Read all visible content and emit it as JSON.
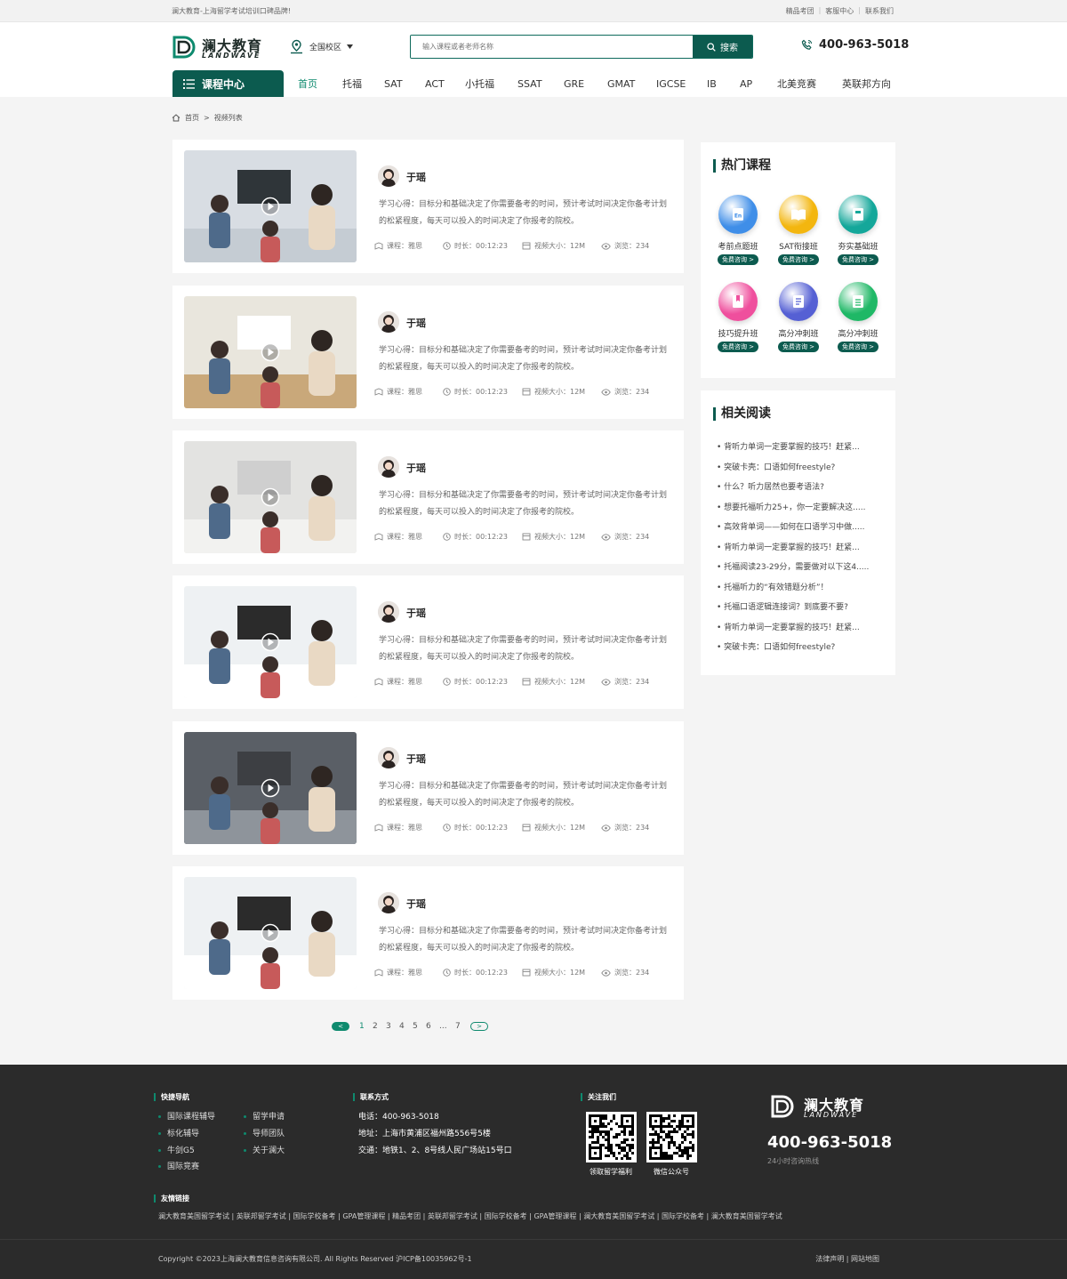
{
  "topbar": {
    "slogan": "澜大教育-上海留学考试培训口碑品牌!",
    "links": [
      "精品考团",
      "客服中心",
      "联系我们"
    ]
  },
  "header": {
    "logo_cn": "澜大教育",
    "logo_en": "LANDWAVE",
    "campus": "全国校区",
    "search_placeholder": "输入课程或者老师名称",
    "search_button": "搜索",
    "phone": "400-963-5018"
  },
  "nav": {
    "category_label": "课程中心",
    "items": [
      "首页",
      "托福",
      "SAT",
      "ACT",
      "小托福",
      "SSAT",
      "GRE",
      "GMAT",
      "IGCSE",
      "IB",
      "AP",
      "北美竞赛",
      "英联邦方向"
    ]
  },
  "breadcrumb": {
    "home": "首页",
    "sep": ">",
    "current": "视频列表"
  },
  "videos": [
    {
      "teacher": "于瑶",
      "desc": "学习心得：目标分和基础决定了你需要备考的时间，预计考试时间决定你备考计划的松紧程度，每天可以投入的时间决定了你报考的院校。",
      "course": "课程：雅思",
      "duration": "时长：00:12:23",
      "size": "视频大小：12M",
      "views": "浏览：234"
    },
    {
      "teacher": "于瑶",
      "desc": "学习心得：目标分和基础决定了你需要备考的时间，预计考试时间决定你备考计划的松紧程度，每天可以投入的时间决定了你报考的院校。",
      "course": "课程：雅思",
      "duration": "时长：00:12:23",
      "size": "视频大小：12M",
      "views": "浏览：234"
    },
    {
      "teacher": "于瑶",
      "desc": "学习心得：目标分和基础决定了你需要备考的时间，预计考试时间决定你备考计划的松紧程度，每天可以投入的时间决定了你报考的院校。",
      "course": "课程：雅思",
      "duration": "时长：00:12:23",
      "size": "视频大小：12M",
      "views": "浏览：234"
    },
    {
      "teacher": "于瑶",
      "desc": "学习心得：目标分和基础决定了你需要备考的时间，预计考试时间决定你备考计划的松紧程度，每天可以投入的时间决定了你报考的院校。",
      "course": "课程：雅思",
      "duration": "时长：00:12:23",
      "size": "视频大小：12M",
      "views": "浏览：234"
    },
    {
      "teacher": "于瑶",
      "desc": "学习心得：目标分和基础决定了你需要备考的时间，预计考试时间决定你备考计划的松紧程度，每天可以投入的时间决定了你报考的院校。",
      "course": "课程：雅思",
      "duration": "时长：00:12:23",
      "size": "视频大小：12M",
      "views": "浏览：234"
    },
    {
      "teacher": "于瑶",
      "desc": "学习心得：目标分和基础决定了你需要备考的时间，预计考试时间决定你备考计划的松紧程度，每天可以投入的时间决定了你报考的院校。",
      "course": "课程：雅思",
      "duration": "时长：00:12:23",
      "size": "视频大小：12M",
      "views": "浏览：234"
    }
  ],
  "pagination": {
    "pages": [
      "1",
      "2",
      "3",
      "4",
      "5",
      "6",
      "...",
      "7"
    ],
    "prev": "<",
    "next": ">"
  },
  "hot_courses": {
    "title": "热门课程",
    "button": "免费咨询 >",
    "items": [
      {
        "label": "考前点题班",
        "color": "#3f8ee8",
        "icon": "en-book-icon"
      },
      {
        "label": "SAT衔接班",
        "color": "#f3b60f",
        "icon": "open-book-icon"
      },
      {
        "label": "夯实基础班",
        "color": "#14a79a",
        "icon": "notebook-icon"
      },
      {
        "label": "技巧提升班",
        "color": "#ef4f9d",
        "icon": "bookmark-icon"
      },
      {
        "label": "高分冲刺班",
        "color": "#5560d4",
        "icon": "document-icon"
      },
      {
        "label": "高分冲刺班",
        "color": "#1fb866",
        "icon": "list-doc-icon"
      }
    ]
  },
  "related": {
    "title": "相关阅读",
    "items": [
      "背听力单词一定要掌握的技巧！赶紧...",
      "突破卡壳：口语如何freestyle?",
      "什么？听力居然也要考语法?",
      "想要托福听力25+，你一定要解决这.....",
      "高效背单词——如何在口语学习中做.....",
      "背听力单词一定要掌握的技巧！赶紧...",
      "托福阅读23-29分，需要做对以下这4.....",
      "托福听力的“有效错题分析”！",
      "托福口语逻辑连接词？到底要不要?",
      "背听力单词一定要掌握的技巧！赶紧...",
      "突破卡壳：口语如何freestyle?"
    ]
  },
  "footer": {
    "nav_title": "快捷导航",
    "nav_col1": [
      "国际课程辅导",
      "标化辅导",
      "牛剑G5",
      "国际竞赛"
    ],
    "nav_col2": [
      "留学申请",
      "导师团队",
      "关于澜大"
    ],
    "contact_title": "联系方式",
    "contact": [
      "电话：400-963-5018",
      "地址：上海市黄浦区福州路556号5楼",
      "交通：地铁1、2、8号线人民广场站15号口"
    ],
    "follow_title": "关注我们",
    "qr_labels": [
      "领取留学福利",
      "微信公众号"
    ],
    "logo_cn": "澜大教育",
    "logo_en": "LANDWAVE",
    "phone": "400-963-5018",
    "hotline": "24小时咨询热线",
    "friends_title": "友情链接",
    "friends": "澜大教育美国留学考试 | 英联邦留学考试 | 国际学校备考 | GPA管理课程 | 精品考团 | 英联邦留学考试 | 国际学校备考 | GPA管理课程 | 澜大教育美国留学考试 | 国际学校备考 | 澜大教育美国留学考试",
    "copyright": "Copyright ©2023上海澜大教育信息咨询有限公司. All Rights Reserved   沪ICP备10035962号-1",
    "legal": "法律声明 | 网站地图"
  }
}
